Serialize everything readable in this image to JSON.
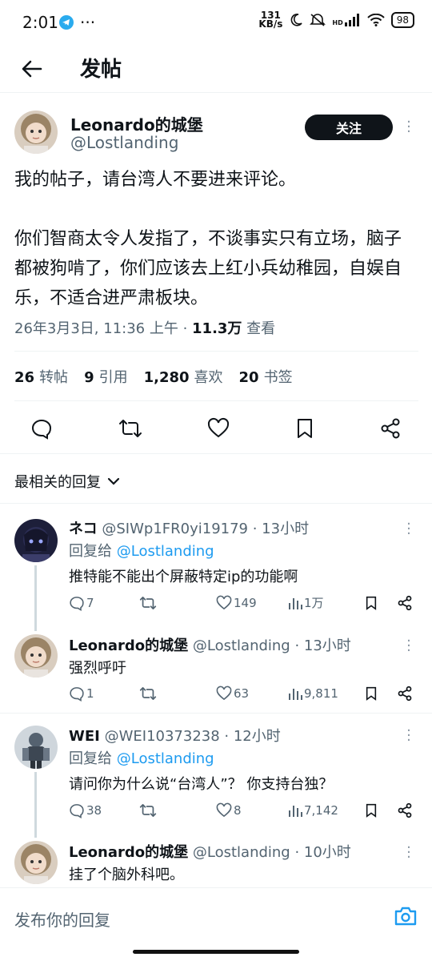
{
  "status_bar": {
    "time": "2:01",
    "network_speed_value": "131",
    "network_speed_unit": "KB/s",
    "hd_label": "HD",
    "battery": "98"
  },
  "header": {
    "title": "发帖"
  },
  "post": {
    "author_name": "Leonardo的城堡",
    "author_handle": "@Lostlanding",
    "follow_label": "关注",
    "text": "我的帖子，请台湾人不要进来评论。\n\n你们智商太令人发指了，不谈事实只有立场，脑子都被狗啃了，你们应该去上红小兵幼稚园，自娱自乐，不适合进严肃板块。",
    "timestamp": "26年3月3日, 11:36 上午 · ",
    "views_count": "11.3万",
    "views_label": " 查看",
    "stats": [
      {
        "num": "26",
        "label": "转帖"
      },
      {
        "num": "9",
        "label": "引用"
      },
      {
        "num": "1,280",
        "label": "喜欢"
      },
      {
        "num": "20",
        "label": "书签"
      }
    ]
  },
  "replies_section": {
    "sort_label": "最相关的回复"
  },
  "replies": [
    {
      "name": "ネコ",
      "handle": "@SIWp1FR0yi19179 · 13小时",
      "replying_prefix": "回复给 ",
      "replying_to": "@Lostlanding",
      "text": "推特能不能出个屏蔽特定ip的功能啊",
      "comments": "7",
      "retweets": "",
      "likes": "149",
      "views": "1万"
    },
    {
      "name": "Leonardo的城堡",
      "handle": "@Lostlanding · 13小时",
      "text": "强烈呼吁",
      "comments": "1",
      "retweets": "",
      "likes": "63",
      "views": "9,811"
    },
    {
      "name": "WEI",
      "handle": "@WEI10373238 · 12小时",
      "replying_prefix": "回复给 ",
      "replying_to": "@Lostlanding",
      "text": "请问你为什么说“台湾人”？ 你支持台独？",
      "comments": "38",
      "retweets": "",
      "likes": "8",
      "views": "7,142"
    },
    {
      "name": "Leonardo的城堡",
      "handle": "@Lostlanding · 10小时",
      "text": "挂了个脑外科吧。"
    }
  ],
  "compose": {
    "placeholder": "发布你的回复"
  },
  "colors": {
    "link": "#1d9bf0",
    "text": "#0f1419",
    "secondary": "#536471",
    "button": "#0f1419"
  }
}
